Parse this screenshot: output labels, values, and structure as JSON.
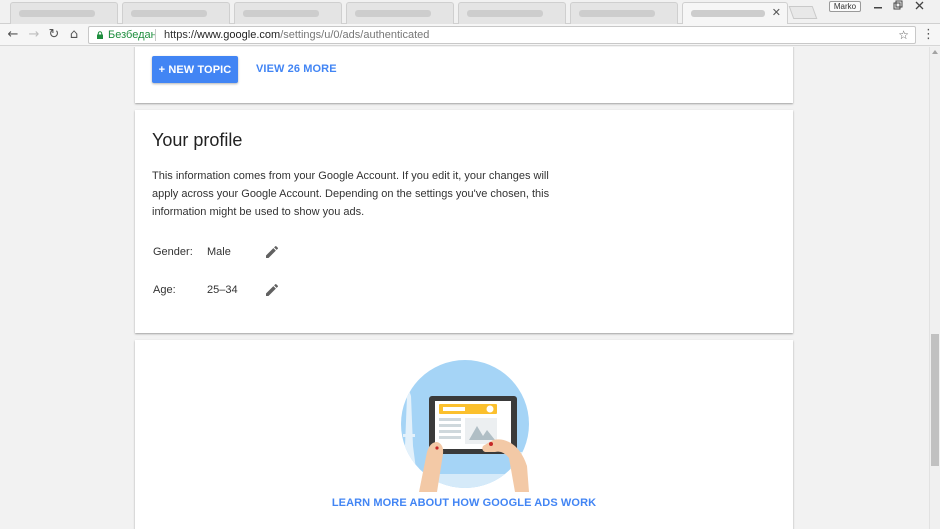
{
  "browser": {
    "profile_name": "Marko",
    "window_controls": {
      "minimize_icon": "minimize-icon",
      "restore_icon": "restore-icon",
      "close_icon": "close-icon"
    },
    "tab_close_glyph": "✕",
    "nav": {
      "back_glyph": "←",
      "forward_glyph": "→",
      "reload_glyph": "↻",
      "home_glyph": "⌂"
    },
    "security_label": "Безбедан",
    "url": {
      "scheme": "https://",
      "host": "www.google.com",
      "path": "/settings/u/0/ads/authenticated"
    },
    "bookmark_glyph": "☆",
    "menu_glyph": "⋮"
  },
  "topics": {
    "new_topic_label": "+ NEW TOPIC",
    "view_more_label": "VIEW 26 MORE"
  },
  "profile": {
    "title": "Your profile",
    "description": "This information comes from your Google Account. If you edit it, your changes will apply across your Google Account. Depending on the settings you've chosen, this information might be used to show you ads.",
    "gender": {
      "label": "Gender:",
      "value": "Male",
      "edit_icon": "pencil-icon"
    },
    "age": {
      "label": "Age:",
      "value": "25–34",
      "edit_icon": "pencil-icon"
    }
  },
  "learn_more": {
    "illustration_icon": "tablet-ads-illustration",
    "link_label": "LEARN MORE ABOUT HOW GOOGLE ADS WORK"
  },
  "colors": {
    "accent_blue": "#4285f4",
    "secure_green": "#1e8e3e",
    "page_background": "#f2f2f2",
    "illustration_sky": "#a5d4f6"
  }
}
